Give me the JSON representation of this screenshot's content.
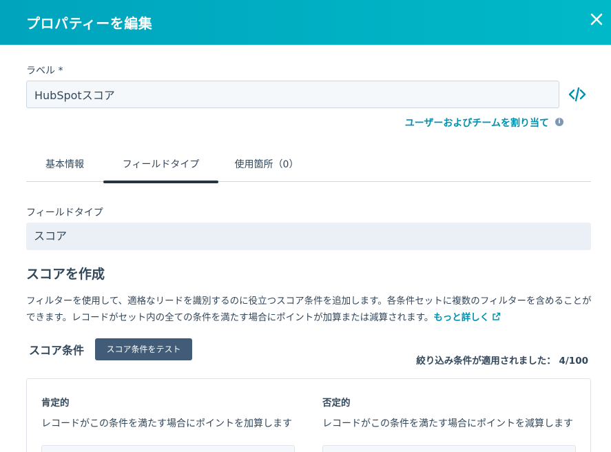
{
  "header": {
    "title": "プロパティーを編集"
  },
  "label_field": {
    "label": "ラベル *",
    "value": "HubSpotスコア"
  },
  "assign_link": "ユーザーおよびチームを割り当て",
  "tabs": [
    {
      "label": "基本情報"
    },
    {
      "label": "フィールドタイプ",
      "active": true
    },
    {
      "label": "使用箇所（0）"
    }
  ],
  "field_type": {
    "label": "フィールドタイプ",
    "value": "スコア"
  },
  "score_section": {
    "title": "スコアを作成",
    "description": "フィルターを使用して、適格なリードを識別するのに役立つスコア条件を追加します。各条件セットに複数のフィルターを含めることができます。レコードがセット内の全ての条件を満たす場合にポイントが加算または減算されます。",
    "learn_more": "もっと詳しく"
  },
  "conditions": {
    "title": "スコア条件",
    "test_button": "スコア条件をテスト",
    "filters_applied_label": "絞り込み条件が適用されました：",
    "filters_applied_value": "4/100"
  },
  "columns": {
    "positive": {
      "title": "肯定的",
      "description": "レコードがこの条件を満たす場合にポイントを加算します"
    },
    "negative": {
      "title": "否定的",
      "description": "レコードがこの条件を満たす場合にポイントを減算します"
    }
  },
  "colors": {
    "header": "#00a4bd",
    "link": "#0091ae",
    "button": "#425b76",
    "text": "#33475b"
  }
}
